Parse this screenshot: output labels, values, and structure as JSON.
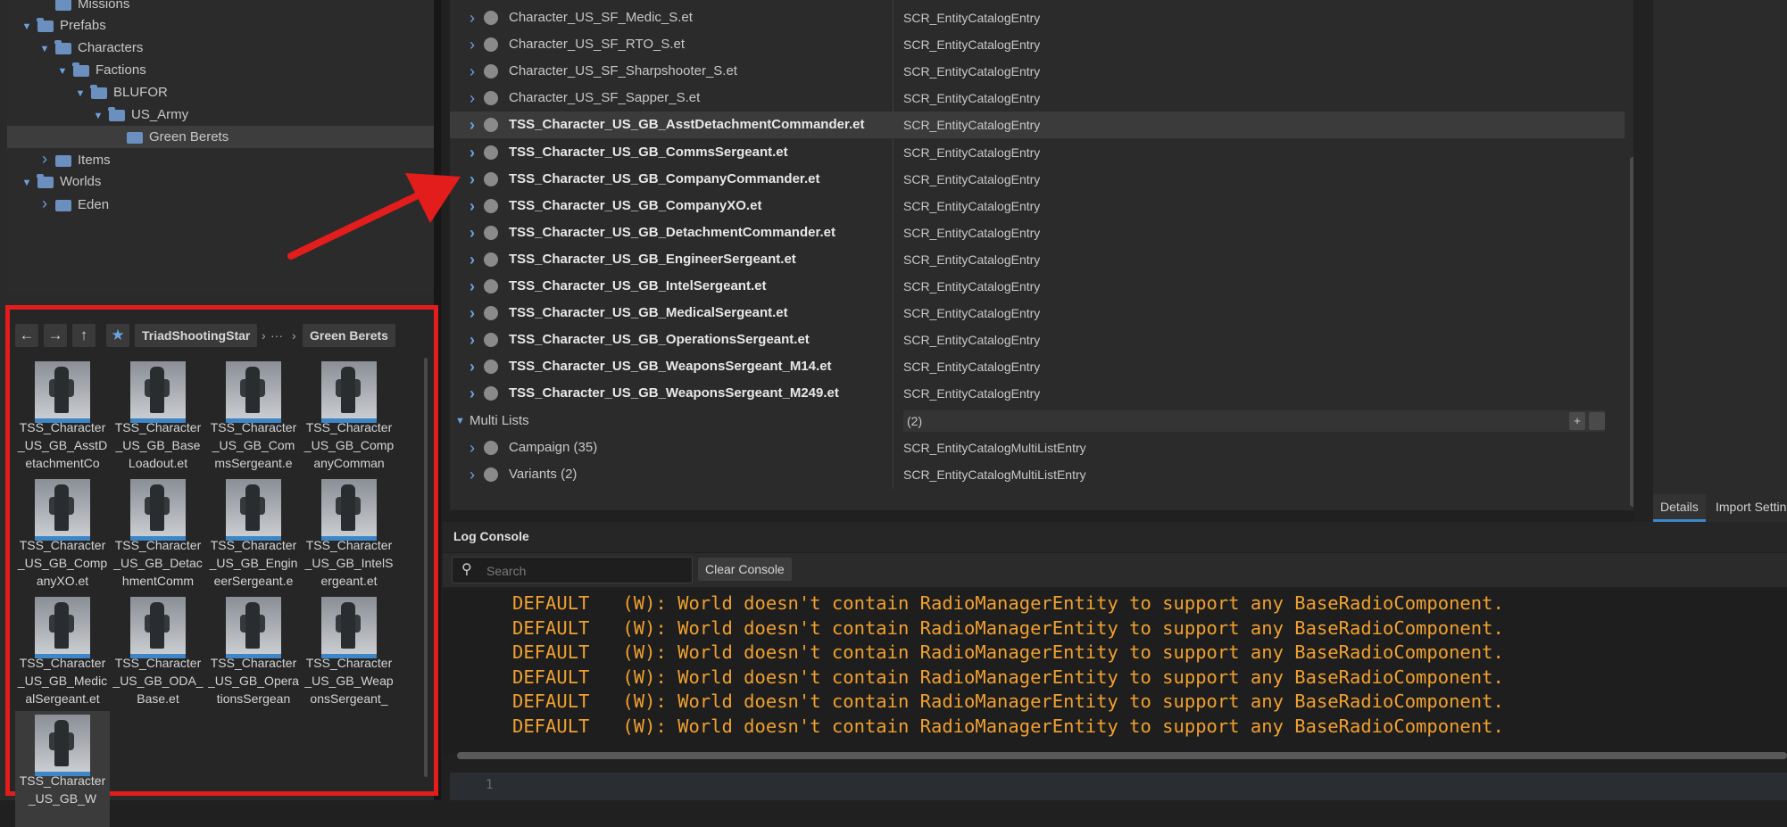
{
  "tree": [
    {
      "label": "Missions",
      "level": 2,
      "expand": "",
      "open": false
    },
    {
      "label": "Prefabs",
      "level": 1,
      "expand": "down",
      "open": true
    },
    {
      "label": "Characters",
      "level": 2,
      "expand": "down",
      "open": true
    },
    {
      "label": "Factions",
      "level": 3,
      "expand": "down",
      "open": true
    },
    {
      "label": "BLUFOR",
      "level": 4,
      "expand": "down",
      "open": true
    },
    {
      "label": "US_Army",
      "level": 5,
      "expand": "down",
      "open": true
    },
    {
      "label": "Green Berets",
      "level": 6,
      "expand": "",
      "open": false,
      "selected": true
    },
    {
      "label": "Items",
      "level": 2,
      "expand": "right",
      "open": false
    },
    {
      "label": "Worlds",
      "level": 1,
      "expand": "down",
      "open": true
    },
    {
      "label": "Eden",
      "level": 2,
      "expand": "right",
      "open": false
    }
  ],
  "breadcrumb": {
    "root": "TriadShootingStar",
    "ellipsis": "···",
    "current": "Green Berets"
  },
  "toolbar_icons": [
    "back-arrow-icon",
    "forward-arrow-icon",
    "up-arrow-icon",
    "star-icon"
  ],
  "assets": [
    "TSS_Character_US_GB_AsstDetachmentCo",
    "TSS_Character_US_GB_BaseLoadout.et",
    "TSS_Character_US_GB_CommsSergeant.e",
    "TSS_Character_US_GB_CompanyComman",
    "TSS_Character_US_GB_CompanyXO.et",
    "TSS_Character_US_GB_DetachmentComm",
    "TSS_Character_US_GB_EngineerSergeant.e",
    "TSS_Character_US_GB_IntelSergeant.et",
    "TSS_Character_US_GB_MedicalSergeant.et",
    "TSS_Character_US_GB_ODA_Base.et",
    "TSS_Character_US_GB_OperationsSergean",
    "TSS_Character_US_GB_WeaponsSergeant_",
    "TSS_Character_US_GB_W"
  ],
  "catalog": {
    "rows": [
      {
        "name": "Character_US_SF_Medic_S.et",
        "type": "SCR_EntityCatalogEntry",
        "bold": false
      },
      {
        "name": "Character_US_SF_RTO_S.et",
        "type": "SCR_EntityCatalogEntry",
        "bold": false
      },
      {
        "name": "Character_US_SF_Sharpshooter_S.et",
        "type": "SCR_EntityCatalogEntry",
        "bold": false
      },
      {
        "name": "Character_US_SF_Sapper_S.et",
        "type": "SCR_EntityCatalogEntry",
        "bold": false
      },
      {
        "name": "TSS_Character_US_GB_AsstDetachmentCommander.et",
        "type": "SCR_EntityCatalogEntry",
        "bold": true,
        "highlight": true
      },
      {
        "name": "TSS_Character_US_GB_CommsSergeant.et",
        "type": "SCR_EntityCatalogEntry",
        "bold": true
      },
      {
        "name": "TSS_Character_US_GB_CompanyCommander.et",
        "type": "SCR_EntityCatalogEntry",
        "bold": true
      },
      {
        "name": "TSS_Character_US_GB_CompanyXO.et",
        "type": "SCR_EntityCatalogEntry",
        "bold": true
      },
      {
        "name": "TSS_Character_US_GB_DetachmentCommander.et",
        "type": "SCR_EntityCatalogEntry",
        "bold": true
      },
      {
        "name": "TSS_Character_US_GB_EngineerSergeant.et",
        "type": "SCR_EntityCatalogEntry",
        "bold": true
      },
      {
        "name": "TSS_Character_US_GB_IntelSergeant.et",
        "type": "SCR_EntityCatalogEntry",
        "bold": true
      },
      {
        "name": "TSS_Character_US_GB_MedicalSergeant.et",
        "type": "SCR_EntityCatalogEntry",
        "bold": true
      },
      {
        "name": "TSS_Character_US_GB_OperationsSergeant.et",
        "type": "SCR_EntityCatalogEntry",
        "bold": true
      },
      {
        "name": "TSS_Character_US_GB_WeaponsSergeant_M14.et",
        "type": "SCR_EntityCatalogEntry",
        "bold": true
      },
      {
        "name": "TSS_Character_US_GB_WeaponsSergeant_M249.et",
        "type": "SCR_EntityCatalogEntry",
        "bold": true
      }
    ],
    "multi_lists": {
      "label": "Multi Lists",
      "count": "(2)",
      "add": "+"
    },
    "sub_rows": [
      {
        "name": "Campaign (35)",
        "type": "SCR_EntityCatalogMultiListEntry"
      },
      {
        "name": "Variants (2)",
        "type": "SCR_EntityCatalogMultiListEntry"
      }
    ]
  },
  "side_tabs": {
    "details": "Details",
    "import": "Import Settings"
  },
  "log": {
    "title": "Log Console",
    "search_placeholder": "Search",
    "clear_label": "Clear Console",
    "lines": [
      "DEFAULT   (W): World doesn't contain RadioManagerEntity to support any BaseRadioComponent.",
      "DEFAULT   (W): World doesn't contain RadioManagerEntity to support any BaseRadioComponent.",
      "DEFAULT   (W): World doesn't contain RadioManagerEntity to support any BaseRadioComponent.",
      "DEFAULT   (W): World doesn't contain RadioManagerEntity to support any BaseRadioComponent.",
      "DEFAULT   (W): World doesn't contain RadioManagerEntity to support any BaseRadioComponent.",
      "DEFAULT   (W): World doesn't contain RadioManagerEntity to support any BaseRadioComponent."
    ],
    "line_number": "1"
  },
  "colors": {
    "annotation": "#e31c1c",
    "warning_text": "#f0a030",
    "folder": "#6b8fbf",
    "accent": "#3d86c8"
  }
}
